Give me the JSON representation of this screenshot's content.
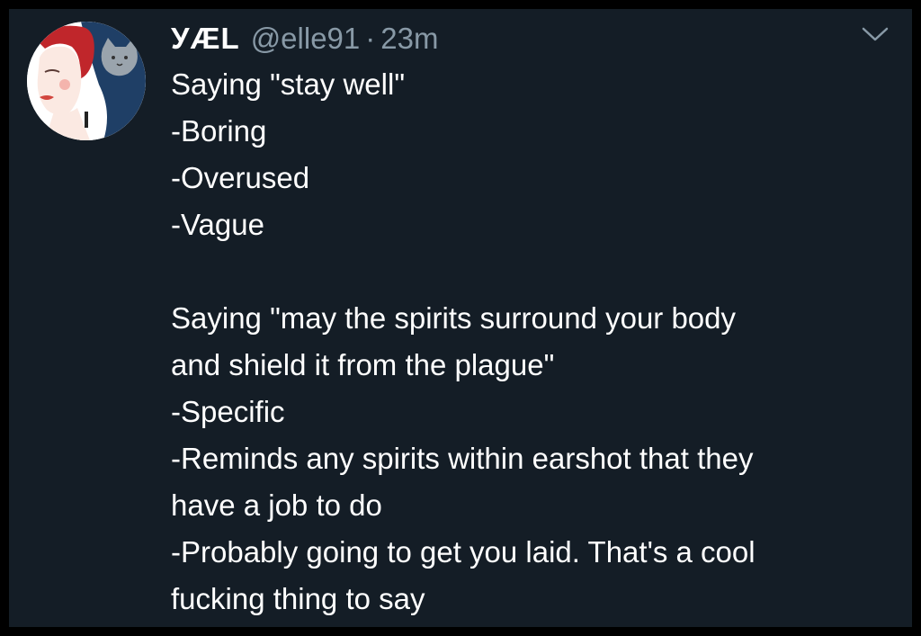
{
  "tweet": {
    "author": {
      "display_name": "УÆL",
      "handle": "@elle91",
      "separator": "·",
      "timestamp": "23m",
      "avatar_icon": "illustrated-woman-with-cat-avatar"
    },
    "menu_icon": "chevron-down-icon",
    "body": {
      "paragraph1": [
        "Saying \"stay well\"",
        "-Boring",
        "-Overused",
        "-Vague"
      ],
      "paragraph2": [
        "Saying \"may the spirits surround your body",
        "and shield it from the plague\"",
        "-Specific",
        "-Reminds any spirits within earshot that they",
        "have a job to do",
        "-Probably going to get you laid. That's a cool",
        "fucking thing to say"
      ]
    }
  },
  "colors": {
    "background": "#141d26",
    "text": "#ffffff",
    "muted": "#8899a6",
    "avatar_hair": "#c0262b",
    "avatar_bg_blue": "#1f3f66"
  }
}
